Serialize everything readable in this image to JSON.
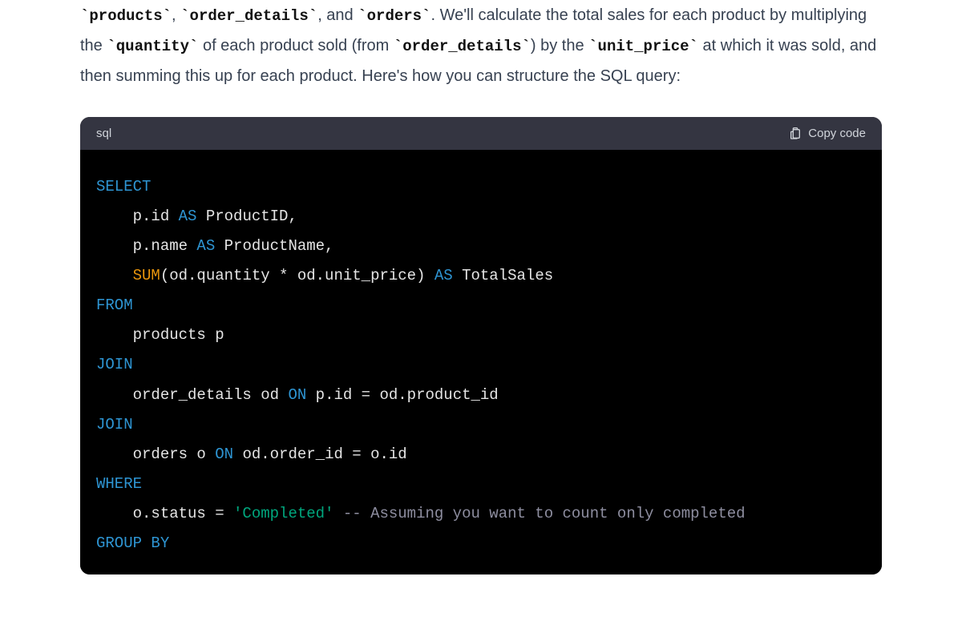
{
  "prose": {
    "code1": "`products`",
    "t1": ", ",
    "code2": "`order_details`",
    "t2": ", and ",
    "code3": "`orders`",
    "t3": ". We'll calculate the total sales for each product by multiplying the ",
    "code4": "`quantity`",
    "t4": " of each product sold (from ",
    "code5": "`order_details`",
    "t5": ") by the ",
    "code6": "`unit_price`",
    "t6": " at which it was sold, and then summing this up for each product. Here's how you can structure the SQL query:"
  },
  "codeBlock": {
    "language": "sql",
    "copyLabel": "Copy code"
  },
  "sql": {
    "l1_kw": "SELECT",
    "l2_a": "    p.id ",
    "l2_kw": "AS",
    "l2_b": " ProductID,",
    "l3_a": "    p.name ",
    "l3_kw": "AS",
    "l3_b": " ProductName,",
    "l4_indent": "    ",
    "l4_func": "SUM",
    "l4_a": "(od.quantity * od.unit_price) ",
    "l4_kw": "AS",
    "l4_b": " TotalSales",
    "l5_kw": "FROM",
    "l6": "    products p",
    "l7_kw": "JOIN",
    "l8_a": "    order_details od ",
    "l8_kw": "ON",
    "l8_b": " p.id = od.product_id",
    "l9_kw": "JOIN",
    "l10_a": "    orders o ",
    "l10_kw": "ON",
    "l10_b": " od.order_id = o.id",
    "l11_kw": "WHERE",
    "l12_a": "    o.status = ",
    "l12_str": "'Completed'",
    "l12_sp": " ",
    "l12_cmt": "-- Assuming you want to count only completed",
    "l13_kw": "GROUP BY"
  }
}
